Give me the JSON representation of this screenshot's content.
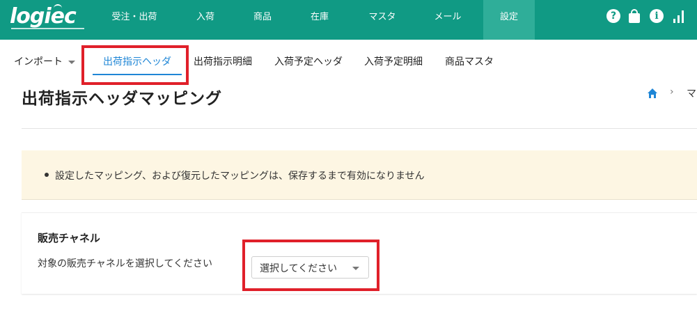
{
  "app": {
    "logo_text": "logiec",
    "nav": [
      {
        "label": "受注・出荷"
      },
      {
        "label": "入荷"
      },
      {
        "label": "商品"
      },
      {
        "label": "在庫"
      },
      {
        "label": "マスタ"
      },
      {
        "label": "メール"
      },
      {
        "label": "設定",
        "active": true
      }
    ],
    "icons": [
      "help-icon",
      "shopping-bag-icon",
      "info-icon",
      "signal-bars-icon"
    ],
    "accent_color": "#109a84"
  },
  "subnav": {
    "import_label": "インポート",
    "tabs": [
      {
        "label": "出荷指示ヘッダ",
        "active": true
      },
      {
        "label": "出荷指示明細"
      },
      {
        "label": "入荷予定ヘッダ"
      },
      {
        "label": "入荷予定明細"
      },
      {
        "label": "商品マスタ"
      }
    ],
    "active_color": "#1f86d6"
  },
  "page": {
    "title": "出荷指示ヘッダマッピング",
    "breadcrumb_sep": "›",
    "breadcrumb_text": "マ"
  },
  "notice": {
    "text": "設定したマッピング、および復元したマッピングは、保存するまで有効になりません"
  },
  "channel_card": {
    "title": "販売チャネル",
    "label": "対象の販売チャネルを選択してください",
    "select_value": "選択してください"
  }
}
